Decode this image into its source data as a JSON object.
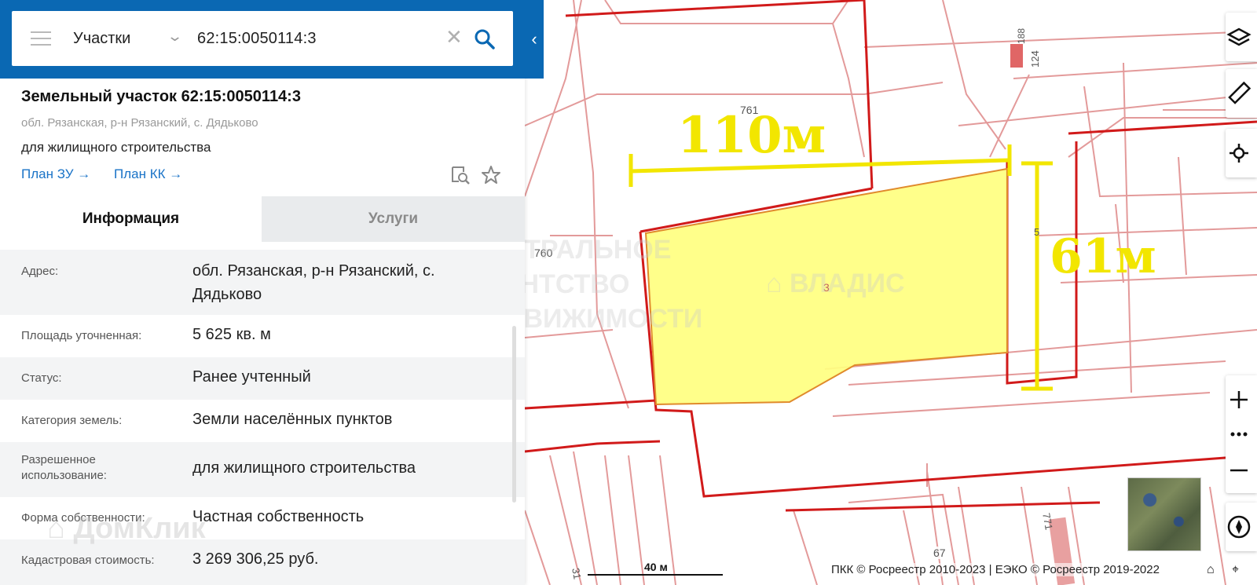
{
  "search": {
    "category": "Участки",
    "query": "62:15:0050114:3"
  },
  "object": {
    "title": "Земельный участок 62:15:0050114:3",
    "address": "обл. Рязанская, р-н Рязанский, с. Дядьково",
    "use": "для жилищного строительства",
    "links": [
      "План ЗУ →",
      "План КК →"
    ]
  },
  "tabs": [
    "Информация",
    "Услуги"
  ],
  "info": [
    {
      "key": "Адрес:",
      "value": "обл. Рязанская, р-н Рязанский, с. Дядьково"
    },
    {
      "key": "Площадь уточненная:",
      "value": "5 625 кв. м"
    },
    {
      "key": "Статус:",
      "value": "Ранее учтенный"
    },
    {
      "key": "Категория земель:",
      "value": "Земли населённых пунктов"
    },
    {
      "key": "Разрешенное использование:",
      "value": "для жилищного строительства"
    },
    {
      "key": "Форма собственности:",
      "value": "Частная собственность"
    },
    {
      "key": "Кадастровая стоимость:",
      "value": "3 269 306,25 руб."
    }
  ],
  "map": {
    "dimension_width": "110м",
    "dimension_height": "61м",
    "parcel_label": "3",
    "labels": [
      "761",
      "760",
      "188",
      "124",
      "5",
      "67",
      "771",
      "31"
    ],
    "scale": "40 м",
    "copyright": "ПКК © Росреестр 2010-2023 | ЕЭКО © Росреестр 2019-2022",
    "colors": {
      "parcel_fill": "#ffff80",
      "boundary": "#d11a1a",
      "dimension": "#f2e600"
    }
  },
  "watermarks": {
    "agency": [
      "ЦЕНТРАЛЬНОЕ",
      "АГЕНТСТВО",
      "НЕДВИЖИМОСТИ"
    ],
    "brand": "ВЛАДИС",
    "domclick": "ДомКлик"
  },
  "icons": [
    "hamburger-icon",
    "chevron-down-icon",
    "close-icon",
    "search-icon",
    "collapse-icon",
    "map-search-icon",
    "star-icon",
    "layers-icon",
    "ruler-icon",
    "locate-icon",
    "zoom-in-icon",
    "more-icon",
    "zoom-out-icon",
    "compass-icon",
    "home-icon"
  ]
}
